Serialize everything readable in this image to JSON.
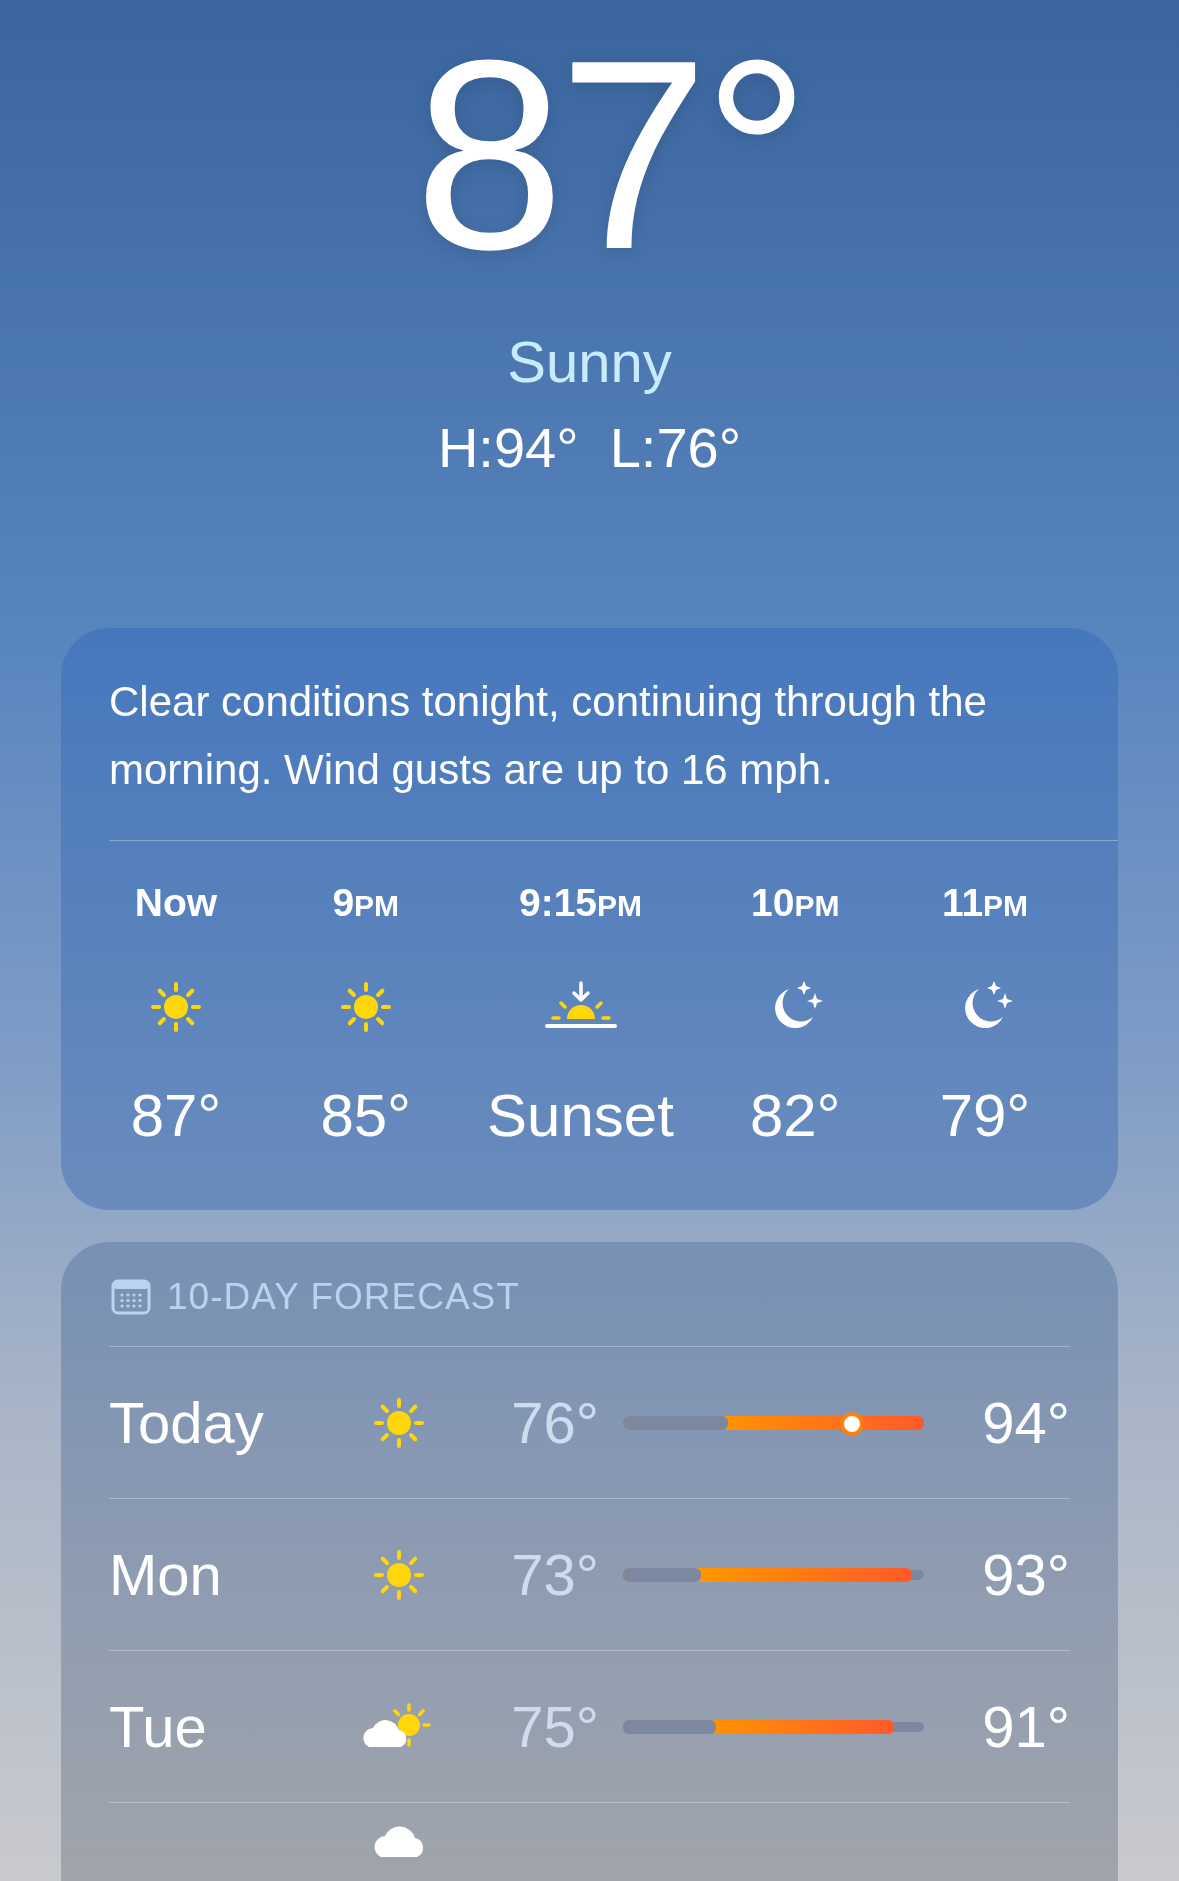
{
  "current": {
    "temperature": "87°",
    "condition": "Sunny",
    "high_low": "H:94°  L:76°"
  },
  "hourly_card": {
    "summary": "Clear conditions tonight, continuing through the morning. Wind gusts are up to 16 mph.",
    "hours": [
      {
        "time": "Now",
        "kind": "sun",
        "value": "87°"
      },
      {
        "time": "9",
        "suffix": "PM",
        "kind": "sun",
        "value": "85°"
      },
      {
        "time": "9:15",
        "suffix": "PM",
        "kind": "sunset",
        "value": "Sunset"
      },
      {
        "time": "10",
        "suffix": "PM",
        "kind": "moon",
        "value": "82°"
      },
      {
        "time": "11",
        "suffix": "PM",
        "kind": "moon",
        "value": "79°"
      }
    ]
  },
  "forecast_card": {
    "title": "10-DAY FORECAST",
    "days": [
      {
        "day": "Today",
        "kind": "sun",
        "low": "76°",
        "high": "94°",
        "bar_start": {
          "level": 0.35
        },
        "bar_end": {
          "level": 1.0
        },
        "current": {
          "level": 0.76
        }
      },
      {
        "day": "Mon",
        "kind": "sun",
        "low": "73°",
        "high": "93°",
        "bar_start": {
          "level": 0.26
        },
        "bar_end": {
          "level": 0.96
        }
      },
      {
        "day": "Tue",
        "kind": "partly-cloudy",
        "low": "75°",
        "high": "91°",
        "bar_start": {
          "level": 0.31
        },
        "bar_end": {
          "level": 0.9
        }
      },
      {
        "kind": "cloud"
      }
    ]
  }
}
